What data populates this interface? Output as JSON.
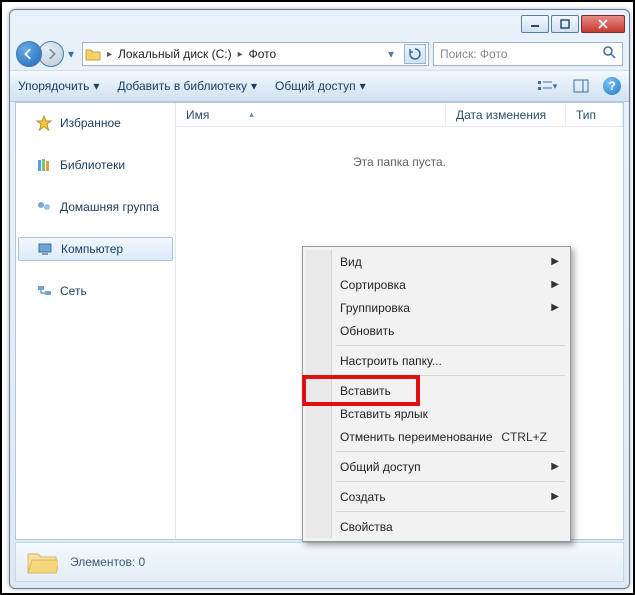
{
  "breadcrumb": {
    "part1": "Локальный диск (C:)",
    "part2": "Фото"
  },
  "search": {
    "placeholder": "Поиск: Фото"
  },
  "toolbar": {
    "organize": "Упорядочить",
    "add_library": "Добавить в библиотеку",
    "share": "Общий доступ"
  },
  "sidebar": {
    "favorites": "Избранное",
    "libraries": "Библиотеки",
    "homegroup": "Домашняя группа",
    "computer": "Компьютер",
    "network": "Сеть"
  },
  "columns": {
    "name": "Имя",
    "modified": "Дата изменения",
    "type": "Тип"
  },
  "main": {
    "empty": "Эта папка пуста."
  },
  "status": {
    "elements": "Элементов: 0"
  },
  "context_menu": {
    "view": "Вид",
    "sort": "Сортировка",
    "group": "Группировка",
    "refresh": "Обновить",
    "customize": "Настроить папку...",
    "paste": "Вставить",
    "paste_shortcut": "Вставить ярлык",
    "undo_rename": "Отменить переименование",
    "undo_shortcut": "CTRL+Z",
    "share": "Общий доступ",
    "new": "Создать",
    "properties": "Свойства"
  }
}
